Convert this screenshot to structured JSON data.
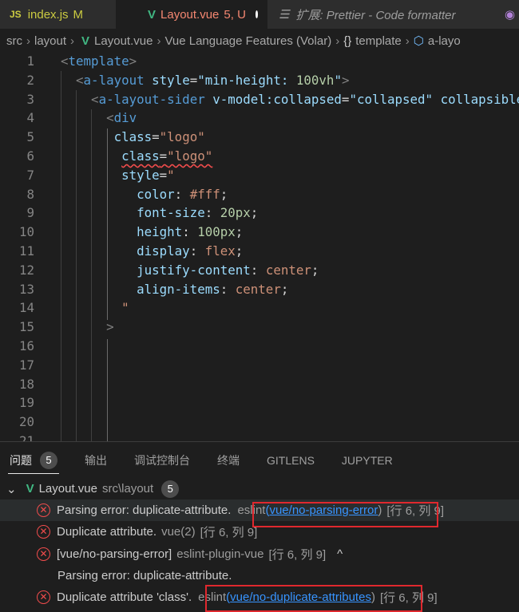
{
  "tabs": [
    {
      "icon": "js-file-icon",
      "icon_text": "JS",
      "label": "index.js",
      "status": "M",
      "color": "#cbcb41"
    },
    {
      "icon": "vue-file-icon",
      "label": "Layout.vue",
      "status": "5, U",
      "color": "#f48771",
      "active": true,
      "dirty": true
    },
    {
      "icon": "preview-icon",
      "label": "扩展: Prettier - Code formatter",
      "color": "#9d9d9d"
    }
  ],
  "breadcrumb": [
    "src",
    "layout",
    "Layout.vue",
    "Vue Language Features (Volar)",
    "template",
    "a-layo"
  ],
  "code_lines": [
    [
      [
        "t-p",
        "<"
      ],
      [
        "t-tag",
        "template"
      ],
      [
        "t-p",
        ">"
      ]
    ],
    [
      [
        "t-txt",
        "  "
      ],
      [
        "t-p",
        "<"
      ],
      [
        "t-tag",
        "a-layout"
      ],
      [
        "t-txt",
        " "
      ],
      [
        "t-attr",
        "style"
      ],
      [
        "t-txt",
        "="
      ],
      [
        "t-attr",
        "\"min-height: "
      ],
      [
        "t-num",
        "100vh"
      ],
      [
        "t-attr",
        "\""
      ],
      [
        "t-p",
        ">"
      ]
    ],
    [
      [
        "t-txt",
        "    "
      ],
      [
        "t-p",
        "<"
      ],
      [
        "t-tag",
        "a-layout-sider"
      ],
      [
        "t-txt",
        " "
      ],
      [
        "t-attr",
        "v-model:collapsed"
      ],
      [
        "t-txt",
        "="
      ],
      [
        "t-attr",
        "\"collapsed\""
      ],
      [
        "t-txt",
        " "
      ],
      [
        "t-attr",
        "collapsible"
      ]
    ],
    [
      [
        "t-txt",
        "      "
      ],
      [
        "t-p",
        "<"
      ],
      [
        "t-tag",
        "div"
      ]
    ],
    [
      [
        "t-txt",
        "       "
      ],
      [
        "t-attr",
        "class"
      ],
      [
        "t-txt",
        "="
      ],
      [
        "t-str",
        "\"logo\""
      ]
    ],
    [
      [
        "t-txt",
        "        "
      ],
      [
        "t-attr squig",
        "class"
      ],
      [
        "t-txt squig",
        "="
      ],
      [
        "t-str squig",
        "\"logo\""
      ]
    ],
    [
      [
        "t-txt",
        "        "
      ],
      [
        "t-attr",
        "style"
      ],
      [
        "t-txt",
        "="
      ],
      [
        "t-str",
        "\""
      ]
    ],
    [
      [
        "t-txt",
        "          "
      ],
      [
        "t-attr",
        "color"
      ],
      [
        "t-txt",
        ": "
      ],
      [
        "t-str",
        "#fff"
      ],
      [
        "t-txt",
        ";"
      ]
    ],
    [
      [
        "t-txt",
        "          "
      ],
      [
        "t-attr",
        "font-size"
      ],
      [
        "t-txt",
        ": "
      ],
      [
        "t-num",
        "20px"
      ],
      [
        "t-txt",
        ";"
      ]
    ],
    [
      [
        "t-txt",
        "          "
      ],
      [
        "t-attr",
        "height"
      ],
      [
        "t-txt",
        ": "
      ],
      [
        "t-num",
        "100px"
      ],
      [
        "t-txt",
        ";"
      ]
    ],
    [
      [
        "t-txt",
        "          "
      ],
      [
        "t-attr",
        "display"
      ],
      [
        "t-txt",
        ": "
      ],
      [
        "t-str",
        "flex"
      ],
      [
        "t-txt",
        ";"
      ]
    ],
    [
      [
        "t-txt",
        "          "
      ],
      [
        "t-attr",
        "justify-content"
      ],
      [
        "t-txt",
        ": "
      ],
      [
        "t-str",
        "center"
      ],
      [
        "t-txt",
        ";"
      ]
    ],
    [
      [
        "t-txt",
        "          "
      ],
      [
        "t-attr",
        "align-items"
      ],
      [
        "t-txt",
        ": "
      ],
      [
        "t-str",
        "center"
      ],
      [
        "t-txt",
        ";"
      ]
    ],
    [
      [
        "t-txt",
        "        "
      ],
      [
        "t-str",
        "\""
      ]
    ],
    [
      [
        "t-txt",
        "      "
      ],
      [
        "t-p",
        ">"
      ]
    ],
    [],
    [],
    [],
    [],
    [],
    []
  ],
  "panel": {
    "tabs": [
      {
        "label": "问题",
        "badge": "5",
        "active": true
      },
      {
        "label": "输出"
      },
      {
        "label": "调试控制台"
      },
      {
        "label": "终端"
      },
      {
        "label": "GITLENS"
      },
      {
        "label": "JUPYTER"
      }
    ],
    "file": {
      "name": "Layout.vue",
      "path": "src\\layout",
      "count": "5"
    },
    "problems": [
      {
        "msg": "Parsing error: duplicate-attribute.",
        "src": "eslint",
        "code": "vue/no-parsing-error",
        "loc": "[行 6, 列 9]",
        "selected": true,
        "highlighted": true
      },
      {
        "msg": "Duplicate attribute.",
        "src": "vue(2)",
        "loc": "[行 6, 列 9]"
      },
      {
        "msg": "[vue/no-parsing-error]",
        "src": "eslint-plugin-vue",
        "loc": "[行 6, 列 9]",
        "expanded": true,
        "detail": "Parsing error: duplicate-attribute."
      },
      {
        "msg": "Duplicate attribute 'class'.",
        "src": "eslint",
        "code": "vue/no-duplicate-attributes",
        "loc": "[行 6, 列 9]",
        "highlighted": true
      }
    ]
  },
  "colors": {
    "error": "#f14c4c",
    "link": "#3794ff",
    "highlight_box": "#e0282e",
    "vue": "#41b883"
  }
}
